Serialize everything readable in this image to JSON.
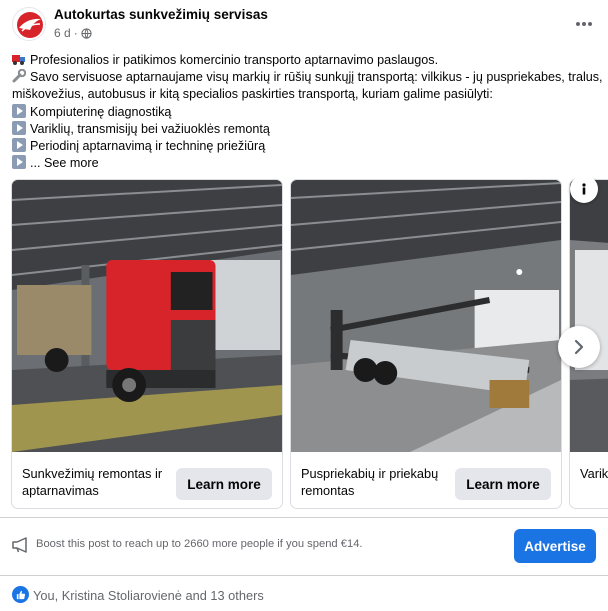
{
  "post": {
    "page_name": "Autokurtas sunkvežimių servisas",
    "time": "6 d",
    "text_lines": [
      "Profesionalios ir patikimos komercinio transporto aptarnavimo  paslaugos.",
      "Savo servisuose aptarnaujame visų markių ir rūšių sunkųjį transportą: vilkikus - jų puspriekabes, tralus,",
      "miškovežius, autobusus  ir kitą specialios paskirties transportą, kuriam galime pasiūlyti:",
      "Kompiuterinę diagnostiką",
      "Variklių, transmisijų bei važiuoklės remontą",
      "Periodinį aptarnavimą ir techninę priežiūrą",
      "... See more"
    ],
    "icons": [
      "truck-emoji",
      "wrench-emoji",
      "play-button-emoji",
      "globe-icon",
      "more-icon"
    ]
  },
  "carousel": {
    "cards": [
      {
        "title": "Sunkvežimių remontas ir aptarnavimas",
        "button": "Learn more"
      },
      {
        "title": "Puspriekabių ir priekabų remontas",
        "button": "Learn more"
      },
      {
        "title": "Variklių remo",
        "button": ""
      }
    ]
  },
  "boost": {
    "text": "Boost this post to reach up to 2660 more people if you spend €14.",
    "button": "Advertise"
  },
  "reactions": {
    "text": "You, Kristina Stoliarovienė and 13 others"
  },
  "colors": {
    "accent": "#1b74e4",
    "secondary_text": "#65676b",
    "button_grey": "#e4e6eb",
    "brand_red": "#d6242a"
  }
}
